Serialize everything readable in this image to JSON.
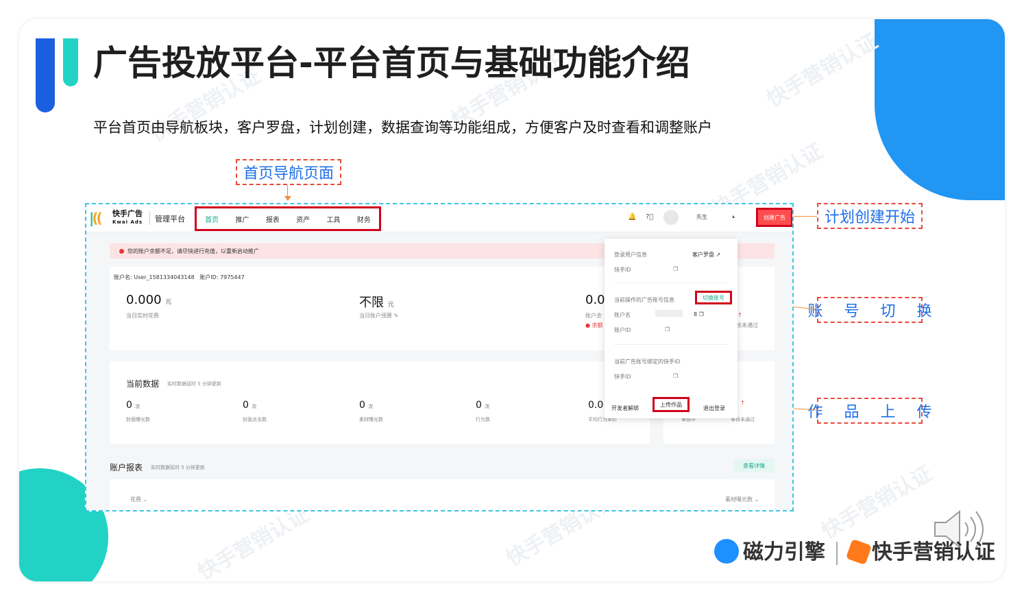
{
  "slide": {
    "title": "广告投放平台-平台首页与基础功能介绍",
    "subtitle": "平台首页由导航板块，客户罗盘，计划创建，数据查询等功能组成，方便客户及时查看和调整账户",
    "watermark": "快手营销认证"
  },
  "callouts": {
    "nav": "首页导航页面",
    "create": "计划创建开始",
    "switch": "账 号 切 换",
    "upload": "作 品 上 传"
  },
  "app": {
    "logo_name": "快手广告",
    "logo_sub": "Kwai Ads",
    "platform": "管理平台",
    "nav": [
      "首页",
      "推广",
      "报表",
      "资产",
      "工具",
      "财务"
    ],
    "user_name": "先生",
    "create_btn": "创建广告",
    "alert": "您的账户余额不足，请尽快进行充值，以重新启动推广",
    "account_name_label": "账户名:",
    "account_name": "User_1581334043148",
    "account_id_label": "账户ID:",
    "account_id": "7975447",
    "spend_value": "0.000",
    "spend_unit": "元",
    "spend_label": "当日实时花费",
    "budget_value": "不限",
    "budget_unit": "元",
    "budget_label": "当日账户预算",
    "balance_value": "0.0",
    "balance_label": "账户余",
    "balance_warn": "余额",
    "review_fail": "核未通过",
    "current_data_title": "当前数据",
    "current_data_note": "实时数据延时 5 分钟更新",
    "metrics": [
      {
        "value": "0",
        "unit": "次",
        "label": "封面曝光数"
      },
      {
        "value": "0",
        "unit": "次",
        "label": "封面点击数"
      },
      {
        "value": "0",
        "unit": "次",
        "label": "素材曝光数"
      },
      {
        "value": "0",
        "unit": "次",
        "label": "行为数"
      },
      {
        "value": "0.0",
        "unit": "",
        "label": "平均行为单价"
      }
    ],
    "reviewing": "审核中",
    "review_fail2": "审核未通过",
    "report_title": "账户报表",
    "report_note": "实时数据延时 5 分钟更新",
    "view_detail": "查看详情",
    "report_left_select": "花费",
    "report_right_select": "素材曝光数"
  },
  "popup": {
    "login_info": "登录用户信息",
    "compass": "客户罗盘",
    "kuaishou_id": "快手ID",
    "current_account_info": "当前操作的广告账号信息",
    "switch_account": "切换账号",
    "account_name": "账户名",
    "account_name_tail": "8",
    "account_id": "账户ID",
    "bound_id": "当前广告账号绑定的快手ID",
    "kuaishou_id2": "快手ID",
    "dev_unbind": "开发者解绑",
    "upload": "上传作品",
    "logout": "退出登录"
  },
  "footer": {
    "brand1": "磁力引擎",
    "brand2": "快手营销认证"
  },
  "colors": {
    "accent_blue": "#1a5fe0",
    "accent_cyan": "#22d3c5",
    "highlight_red": "#d0021b",
    "callout_text": "#1e6fe8"
  }
}
